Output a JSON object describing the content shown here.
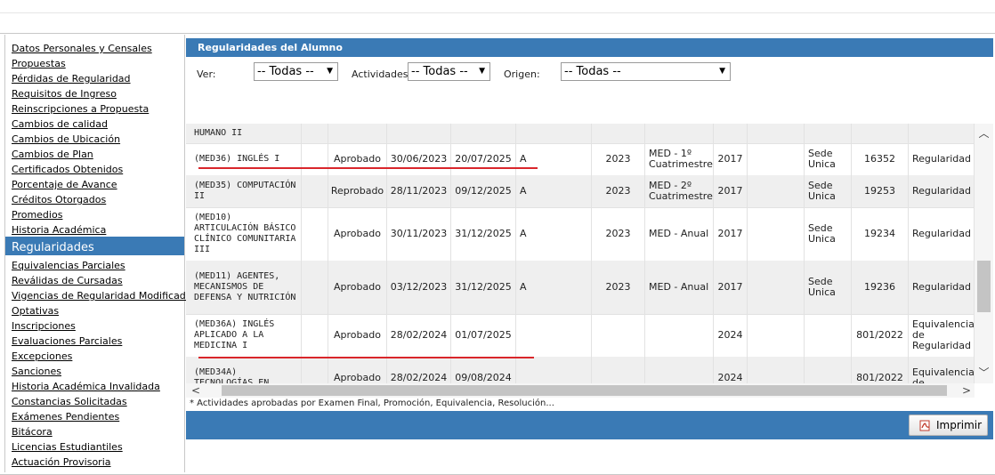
{
  "sidebar": {
    "items": [
      {
        "label": "Datos Personales y Censales",
        "active": false
      },
      {
        "label": "Propuestas",
        "active": false
      },
      {
        "label": "Pérdidas de Regularidad",
        "active": false
      },
      {
        "label": "Requisitos de Ingreso",
        "active": false
      },
      {
        "label": "Reinscripciones a Propuesta",
        "active": false
      },
      {
        "label": "Cambios de calidad",
        "active": false
      },
      {
        "label": "Cambios de Ubicación",
        "active": false
      },
      {
        "label": "Cambios de Plan",
        "active": false
      },
      {
        "label": "Certificados Obtenidos",
        "active": false
      },
      {
        "label": "Porcentaje de Avance",
        "active": false
      },
      {
        "label": "Créditos Otorgados",
        "active": false
      },
      {
        "label": "Promedios",
        "active": false
      },
      {
        "label": "Historia Académica",
        "active": false
      },
      {
        "label": "Regularidades",
        "active": true
      },
      {
        "label": "Equivalencias Parciales",
        "active": false
      },
      {
        "label": "Reválidas de Cursadas",
        "active": false
      },
      {
        "label": "Vigencias de Regularidad Modificadas",
        "active": false
      },
      {
        "label": "Optativas",
        "active": false
      },
      {
        "label": "Inscripciones",
        "active": false
      },
      {
        "label": "Evaluaciones Parciales",
        "active": false
      },
      {
        "label": "Excepciones",
        "active": false
      },
      {
        "label": "Sanciones",
        "active": false
      },
      {
        "label": "Historia Académica Invalidada",
        "active": false
      },
      {
        "label": "Constancias Solicitadas",
        "active": false
      },
      {
        "label": "Exámenes Pendientes",
        "active": false
      },
      {
        "label": "Bitácora",
        "active": false
      },
      {
        "label": "Licencias Estudiantiles",
        "active": false
      },
      {
        "label": "Actuación Provisoria",
        "active": false
      }
    ]
  },
  "panel": {
    "title": "Regularidades del Alumno",
    "filters": {
      "ver": {
        "label": "Ver:",
        "value": "-- Todas --"
      },
      "actividades": {
        "label": "Actividades:",
        "value": "-- Todas --"
      },
      "origen": {
        "label": "Origen:",
        "value": "-- Todas --"
      }
    },
    "rows": [
      {
        "actividad": "HUMANO II",
        "estado": "",
        "fecha": "",
        "vigencia": "",
        "resultado": "",
        "anio": "",
        "periodo": "",
        "plan": "",
        "x": "",
        "sede": "",
        "acta": "",
        "origen": "",
        "partial": true
      },
      {
        "actividad": "(MED36) INGLÉS I",
        "estado": "Aprobado",
        "fecha": "30/06/2023",
        "vigencia": "20/07/2025",
        "resultado": "A",
        "anio": "2023",
        "periodo": "MED - 1º Cuatrimestre",
        "plan": "2017",
        "x": "",
        "sede": "Sede Unica",
        "acta": "16352",
        "origen": "Regularidad"
      },
      {
        "actividad": "(MED35) COMPUTACIÓN II",
        "estado": "Reprobado",
        "fecha": "28/11/2023",
        "vigencia": "09/12/2025",
        "resultado": "A",
        "anio": "2023",
        "periodo": "MED - 2º Cuatrimestre",
        "plan": "2017",
        "x": "",
        "sede": "Sede Unica",
        "acta": "19253",
        "origen": "Regularidad"
      },
      {
        "actividad": "(MED10) ARTICULACIÓN BÁSICO CLÍNICO COMUNITARIA III",
        "estado": "Aprobado",
        "fecha": "30/11/2023",
        "vigencia": "31/12/2025",
        "resultado": "A",
        "anio": "2023",
        "periodo": "MED - Anual",
        "plan": "2017",
        "x": "",
        "sede": "Sede Unica",
        "acta": "19234",
        "origen": "Regularidad"
      },
      {
        "actividad": "(MED11) AGENTES, MECANISMOS DE DEFENSA Y NUTRICIÓN",
        "estado": "Aprobado",
        "fecha": "03/12/2023",
        "vigencia": "31/12/2025",
        "resultado": "A",
        "anio": "2023",
        "periodo": "MED - Anual",
        "plan": "2017",
        "x": "",
        "sede": "Sede Unica",
        "acta": "19236",
        "origen": "Regularidad"
      },
      {
        "actividad": "(MED36A) INGLÉS APLICADO A LA MEDICINA I",
        "estado": "Aprobado",
        "fecha": "28/02/2024",
        "vigencia": "01/07/2025",
        "resultado": "",
        "anio": "",
        "periodo": "",
        "plan": "2024",
        "x": "",
        "sede": "",
        "acta": "801/2022",
        "origen": "Equivalencia de Regularidad"
      },
      {
        "actividad": "(MED34A) TECNOLOGÍAS EN",
        "estado": "Aprobado",
        "fecha": "28/02/2024",
        "vigencia": "09/08/2024",
        "resultado": "",
        "anio": "",
        "periodo": "",
        "plan": "2024",
        "x": "",
        "sede": "",
        "acta": "801/2022",
        "origen": "Equivalencia de"
      }
    ],
    "footnote": "* Actividades aprobadas por Examen Final, Promoción, Equivalencia, Resolución...",
    "print_label": "Imprimir"
  }
}
